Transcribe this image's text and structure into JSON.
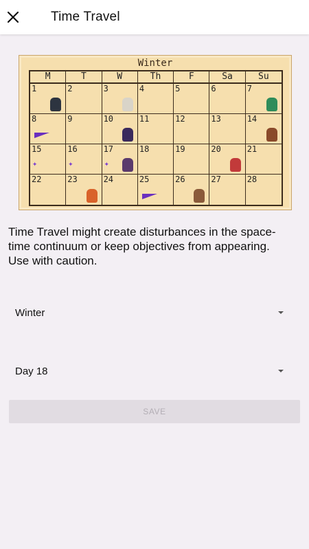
{
  "header": {
    "title": "Time Travel",
    "close_icon": "close-icon"
  },
  "calendar": {
    "season": "Winter",
    "weekdays": [
      "M",
      "T",
      "W",
      "Th",
      "F",
      "Sa",
      "Su"
    ],
    "days": [
      "1",
      "2",
      "3",
      "4",
      "5",
      "6",
      "7",
      "8",
      "9",
      "10",
      "11",
      "12",
      "13",
      "14",
      "15",
      "16",
      "17",
      "18",
      "19",
      "20",
      "21",
      "22",
      "23",
      "24",
      "25",
      "26",
      "27",
      "28"
    ]
  },
  "message": "Time Travel might create disturbances in the space-time continuum or keep objectives from appearing. Use with caution.",
  "season_select": {
    "value": "Winter"
  },
  "day_select": {
    "value": "Day 18"
  },
  "save_button": {
    "label": "SAVE"
  },
  "colors": {
    "background": "#f3eff4",
    "appbar": "#ffffff",
    "calendar_paper": "#f6dfae",
    "save_disabled": "#e1dce2"
  }
}
